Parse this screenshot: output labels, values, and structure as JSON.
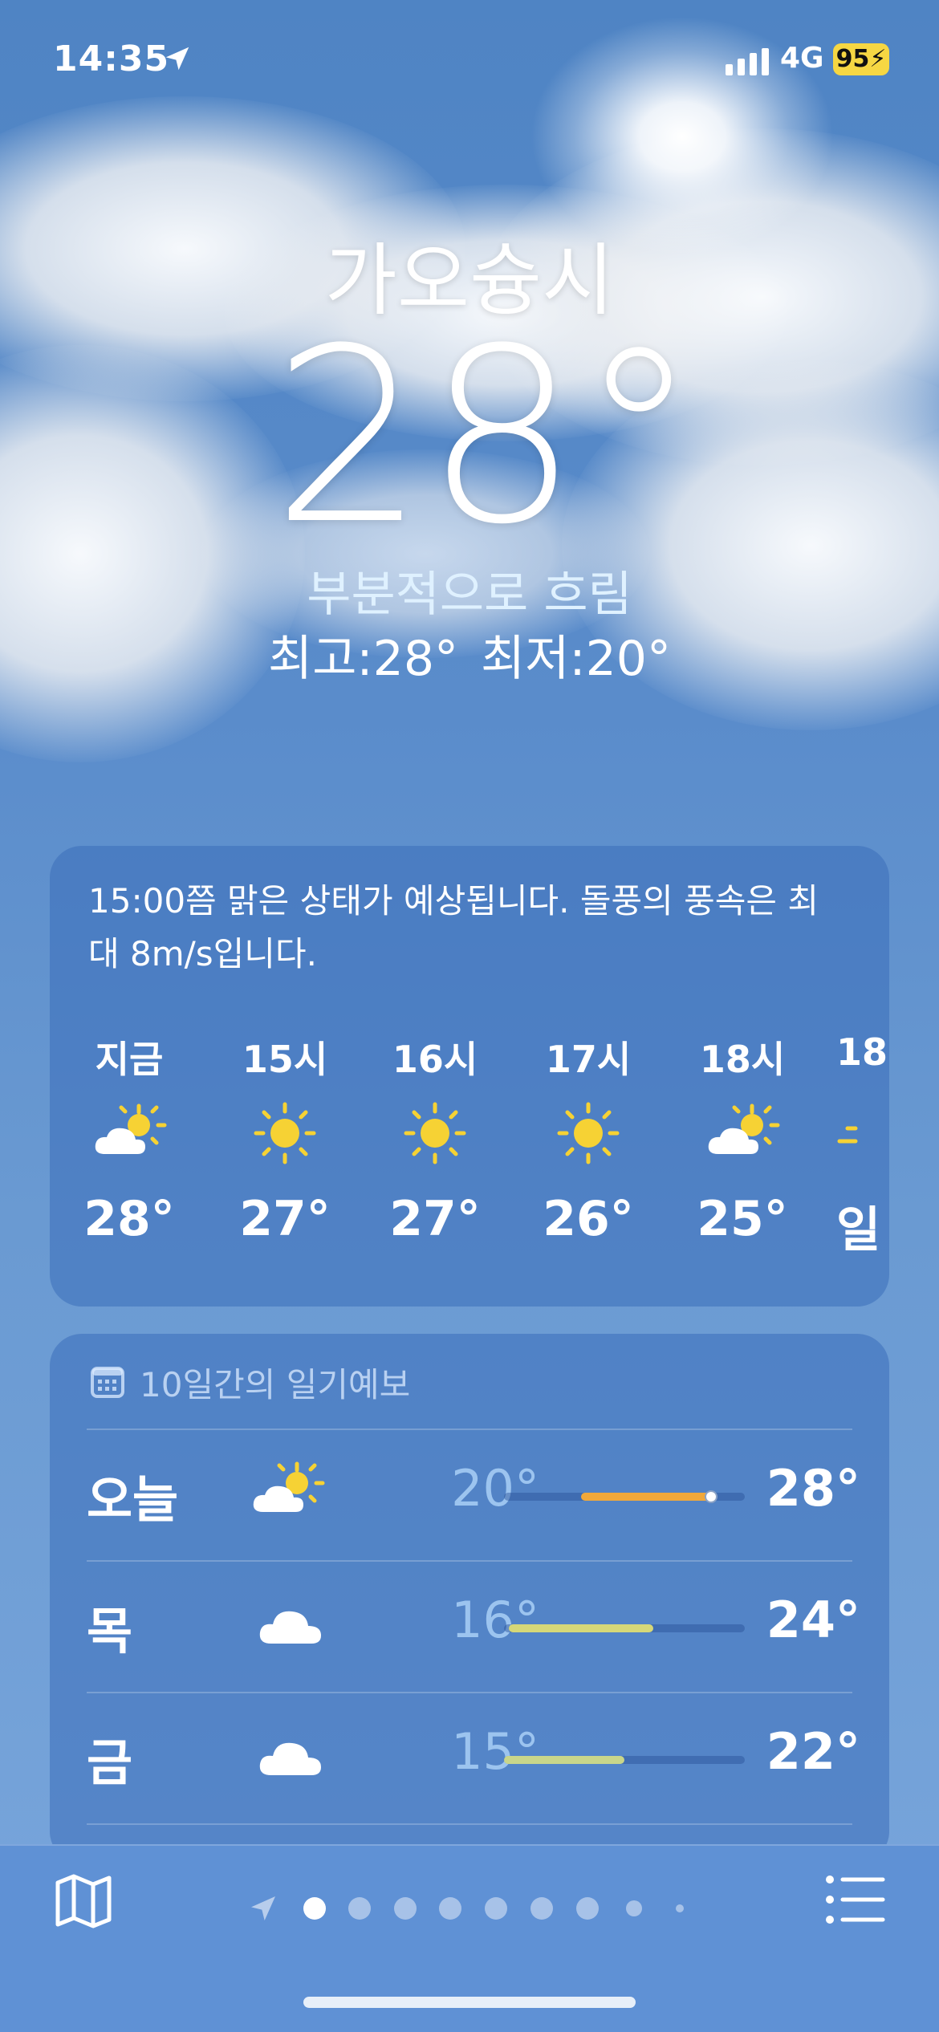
{
  "status_bar": {
    "time": "14:35",
    "network": "4G",
    "battery": "95",
    "battery_color": "#f6d743"
  },
  "location": {
    "city": "가오슝시",
    "temperature": "28°",
    "condition": "부분적으로 흐림",
    "high": "최고:28°",
    "low": "최저:20°"
  },
  "hourly": {
    "summary": "15:00쯤 맑은 상태가 예상됩니다. 돌풍의 풍속은 최대 8m/s입니다.",
    "items": [
      {
        "label": "지금",
        "icon": "partly-sunny-icon",
        "temp": "28°"
      },
      {
        "label": "15시",
        "icon": "sun-icon",
        "temp": "27°"
      },
      {
        "label": "16시",
        "icon": "sun-icon",
        "temp": "27°"
      },
      {
        "label": "17시",
        "icon": "sun-icon",
        "temp": "26°"
      },
      {
        "label": "18시",
        "icon": "partly-sunny-icon",
        "temp": "25°"
      },
      {
        "label": "18",
        "icon": "sunset-icon",
        "temp": "일"
      }
    ]
  },
  "daily": {
    "header": "10일간의 일기예보",
    "days": [
      {
        "name": "오늘",
        "icon": "partly-sunny-icon",
        "low": "20°",
        "high": "28°",
        "range_start": 0.32,
        "range_end": 0.86,
        "current": 0.86,
        "bar_color": "#f0a83a"
      },
      {
        "name": "목",
        "icon": "cloud-icon",
        "low": "16°",
        "high": "24°",
        "range_start": 0.02,
        "range_end": 0.62,
        "bar_color": "#d6d878"
      },
      {
        "name": "금",
        "icon": "cloud-icon",
        "low": "15°",
        "high": "22°",
        "range_start": 0.0,
        "range_end": 0.5,
        "bar_color": "#c9d68a"
      }
    ]
  },
  "bottom_bar": {
    "page_count": 9,
    "active_page": 0
  },
  "colors": {
    "sun": "#f6d234",
    "accent_low": "#9cc4ef"
  }
}
